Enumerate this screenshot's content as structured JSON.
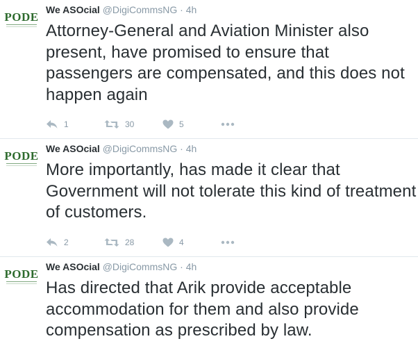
{
  "tweets": [
    {
      "author": "We ASOcial",
      "handle": "@DigiCommsNG",
      "separator": "·",
      "time": "4h",
      "avatar_text": "PODE",
      "text": "Attorney-General and Aviation Minister also present, have promised to ensure that passengers are compensated, and this does not happen again",
      "replies": "1",
      "retweets": "30",
      "likes": "5"
    },
    {
      "author": "We ASOcial",
      "handle": "@DigiCommsNG",
      "separator": "·",
      "time": "4h",
      "avatar_text": "PODE",
      "text": "More importantly, has made it clear that Government will not tolerate this kind of treatment of customers.",
      "replies": "2",
      "retweets": "28",
      "likes": "4"
    },
    {
      "author": "We ASOcial",
      "handle": "@DigiCommsNG",
      "separator": "·",
      "time": "4h",
      "avatar_text": "PODE",
      "text": "Has directed that Arik provide acceptable accommodation for them and also provide compensation as prescribed by law."
    }
  ],
  "icons": {
    "reply": "reply-icon",
    "retweet": "retweet-icon",
    "like": "heart-icon",
    "more": "more-dots-icon"
  },
  "colors": {
    "text": "#292f33",
    "meta": "#8899a6",
    "icon": "#aab8c2",
    "logo": "#2e6b2e",
    "divider": "#e1e8ed"
  }
}
